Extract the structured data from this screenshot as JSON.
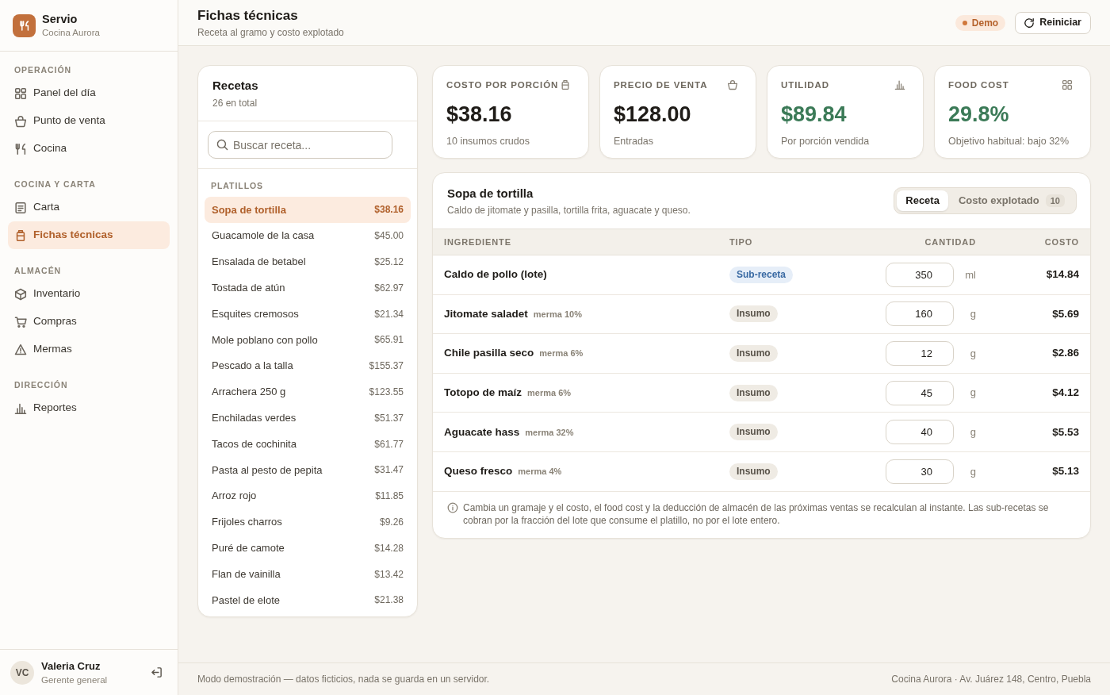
{
  "sidebar": {
    "brand": {
      "name": "Servio",
      "subtitle": "Cocina Aurora"
    },
    "sections": [
      {
        "title": "OPERACIÓN",
        "items": [
          {
            "label": "Panel del día",
            "selected": false
          },
          {
            "label": "Punto de venta",
            "selected": false
          },
          {
            "label": "Cocina",
            "selected": false
          }
        ]
      },
      {
        "title": "COCINA Y CARTA",
        "items": [
          {
            "label": "Carta",
            "selected": false
          },
          {
            "label": "Fichas técnicas",
            "selected": true
          }
        ]
      },
      {
        "title": "ALMACÉN",
        "items": [
          {
            "label": "Inventario",
            "selected": false
          },
          {
            "label": "Compras",
            "selected": false
          },
          {
            "label": "Mermas",
            "selected": false
          }
        ]
      },
      {
        "title": "DIRECCIÓN",
        "items": [
          {
            "label": "Reportes",
            "selected": false
          }
        ]
      }
    ],
    "user": {
      "initials": "VC",
      "name": "Valeria Cruz",
      "role": "Gerente general"
    }
  },
  "header": {
    "title": "Fichas técnicas",
    "subtitle": "Receta al gramo y costo explotado",
    "badge": "Demo",
    "reset_button": "Reiniciar"
  },
  "recipes": {
    "title": "Recetas",
    "count": "26 en total",
    "search": {
      "placeholder": "Buscar receta..."
    },
    "groups": [
      {
        "title": "PLATILLOS",
        "items": [
          {
            "name": "Sopa de tortilla",
            "cost": "$38.16",
            "selected": true
          },
          {
            "name": "Guacamole de la casa",
            "cost": "$45.00",
            "selected": false
          },
          {
            "name": "Ensalada de betabel",
            "cost": "$25.12",
            "selected": false
          },
          {
            "name": "Tostada de atún",
            "cost": "$62.97",
            "selected": false
          },
          {
            "name": "Esquites cremosos",
            "cost": "$21.34",
            "selected": false
          },
          {
            "name": "Mole poblano con pollo",
            "cost": "$65.91",
            "selected": false
          },
          {
            "name": "Pescado a la talla",
            "cost": "$155.37",
            "selected": false
          },
          {
            "name": "Arrachera 250 g",
            "cost": "$123.55",
            "selected": false
          },
          {
            "name": "Enchiladas verdes",
            "cost": "$51.37",
            "selected": false
          },
          {
            "name": "Tacos de cochinita",
            "cost": "$61.77",
            "selected": false
          },
          {
            "name": "Pasta al pesto de pepita",
            "cost": "$31.47",
            "selected": false
          },
          {
            "name": "Arroz rojo",
            "cost": "$11.85",
            "selected": false
          },
          {
            "name": "Frijoles charros",
            "cost": "$9.26",
            "selected": false
          },
          {
            "name": "Puré de camote",
            "cost": "$14.28",
            "selected": false
          },
          {
            "name": "Flan de vainilla",
            "cost": "$13.42",
            "selected": false
          },
          {
            "name": "Pastel de elote",
            "cost": "$21.38",
            "selected": false
          }
        ]
      }
    ]
  },
  "kpis": [
    {
      "label": "COSTO POR PORCIÓN",
      "value": "$38.16",
      "note": "10 insumos crudos",
      "color": "#1f1c18"
    },
    {
      "label": "PRECIO DE VENTA",
      "value": "$128.00",
      "note": "Entradas",
      "color": "#1f1c18"
    },
    {
      "label": "UTILIDAD",
      "value": "$89.84",
      "note": "Por porción vendida",
      "color": "#3b7a57"
    },
    {
      "label": "FOOD COST",
      "value": "29.8%",
      "note": "Objetivo habitual: bajo 32%",
      "color": "#3b7a57"
    }
  ],
  "recipe_detail": {
    "title": "Sopa de tortilla",
    "description": "Caldo de jitomate y pasilla, tortilla frita, aguacate y queso.",
    "views": [
      {
        "label": "Receta",
        "selected": true
      },
      {
        "label": "Costo explotado",
        "count": "10",
        "selected": false
      }
    ],
    "table": {
      "columns": [
        "INGREDIENTE",
        "TIPO",
        "CANTIDAD",
        "COSTO"
      ],
      "rows": [
        {
          "ingredient": "Caldo de pollo (lote)",
          "type": "Sub-receta",
          "kind": "sub_recipe",
          "quantity": "350",
          "unit": "ml",
          "cost": "$14.84"
        },
        {
          "ingredient": "Jitomate saladet",
          "waste": "merma 10%",
          "type": "Insumo",
          "kind": "raw",
          "quantity": "160",
          "unit": "g",
          "cost": "$5.69"
        },
        {
          "ingredient": "Chile pasilla seco",
          "waste": "merma 6%",
          "type": "Insumo",
          "kind": "raw",
          "quantity": "12",
          "unit": "g",
          "cost": "$2.86"
        },
        {
          "ingredient": "Totopo de maíz",
          "waste": "merma 6%",
          "type": "Insumo",
          "kind": "raw",
          "quantity": "45",
          "unit": "g",
          "cost": "$4.12"
        },
        {
          "ingredient": "Aguacate hass",
          "waste": "merma 32%",
          "type": "Insumo",
          "kind": "raw",
          "quantity": "40",
          "unit": "g",
          "cost": "$5.53"
        },
        {
          "ingredient": "Queso fresco",
          "waste": "merma 4%",
          "type": "Insumo",
          "kind": "raw",
          "quantity": "30",
          "unit": "g",
          "cost": "$5.13"
        }
      ]
    },
    "note": "Cambia un gramaje y el costo, el food cost y la deducción de almacén de las próximas ventas se recalculan al instante. Las sub-recetas se cobran por la fracción del lote que consume el platillo, no por el lote entero."
  },
  "footer": {
    "left": "Modo demostración — datos ficticios, nada se guarda en un servidor.",
    "right": "Cocina Aurora · Av. Juárez 148, Centro, Puebla"
  }
}
